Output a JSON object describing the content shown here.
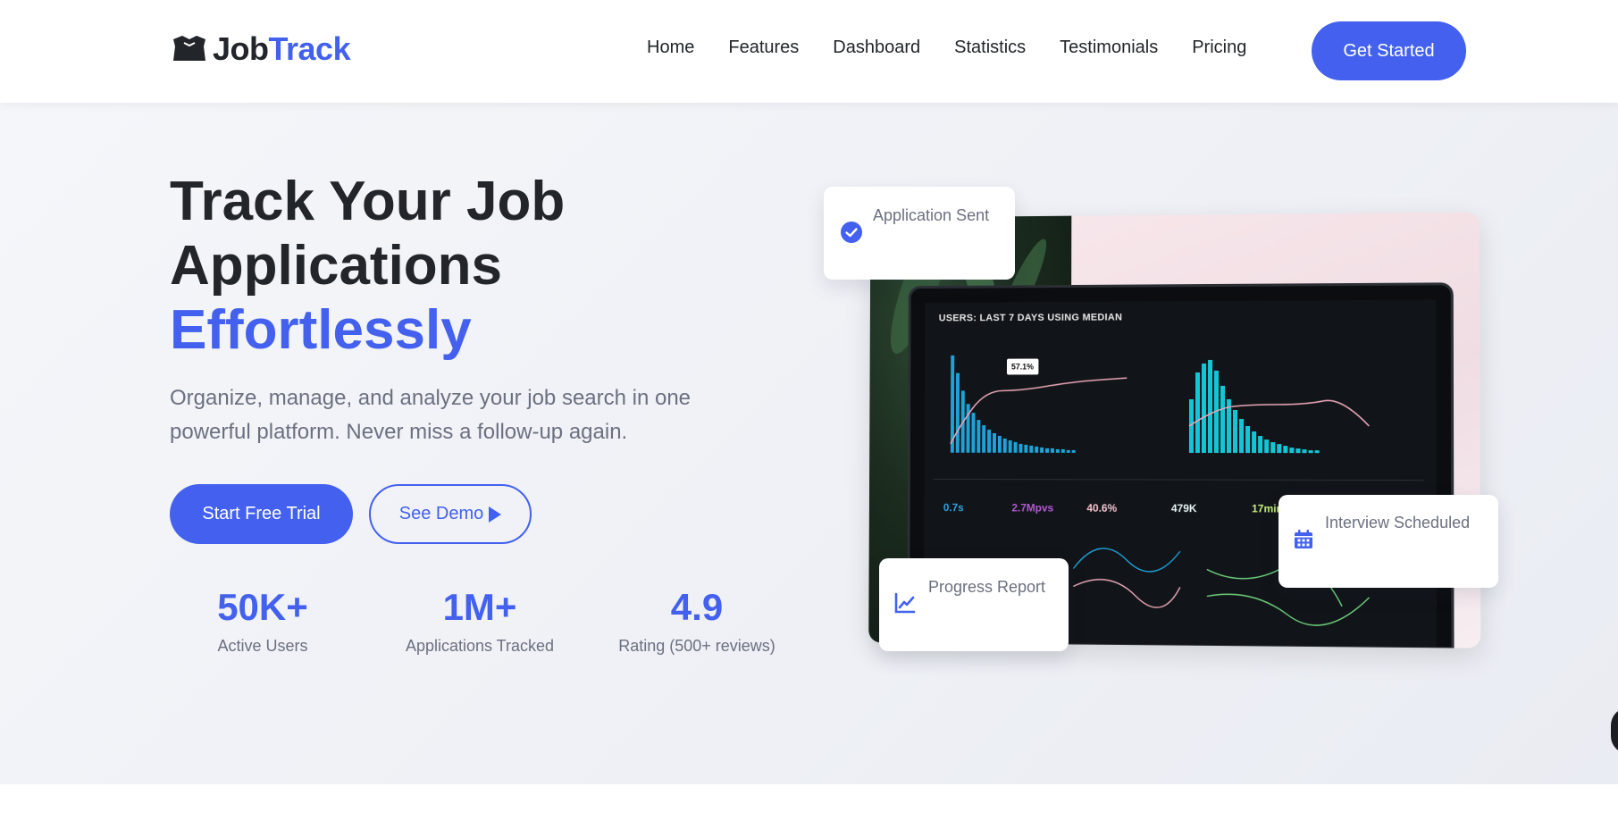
{
  "brand": {
    "part1": "Job",
    "part2": "Track",
    "icon": "briefcase-icon"
  },
  "nav": {
    "links": [
      "Home",
      "Features",
      "Dashboard",
      "Statistics",
      "Testimonials",
      "Pricing"
    ],
    "cta": "Get Started"
  },
  "hero": {
    "title_line1": "Track Your Job",
    "title_line2": "Applications",
    "title_accent": "Effortlessly",
    "description": "Organize, manage, and analyze your job search in one powerful platform. Never miss a follow-up again.",
    "primary_button": "Start Free Trial",
    "secondary_button": "See Demo",
    "stats": [
      {
        "value": "50K+",
        "label": "Active Users"
      },
      {
        "value": "1M+",
        "label": "Applications Tracked"
      },
      {
        "value": "4.9",
        "label": "Rating (500+ reviews)"
      }
    ]
  },
  "cards": {
    "application_sent": "Application Sent",
    "interview_scheduled": "Interview Scheduled",
    "progress_report": "Progress Report"
  },
  "laptop_screen": {
    "header": "USERS: LAST 7 DAYS USING MEDIAN",
    "tooltip": "57.1%",
    "metrics": [
      "0.7s",
      "2.7Mpvs",
      "40.6%",
      "479K",
      "17min"
    ]
  },
  "colors": {
    "accent": "#4361ee",
    "text_dark": "#222529",
    "text_muted": "#6b7080",
    "hero_bg_start": "#f5f6fa",
    "hero_bg_end": "#e9ecf2"
  }
}
